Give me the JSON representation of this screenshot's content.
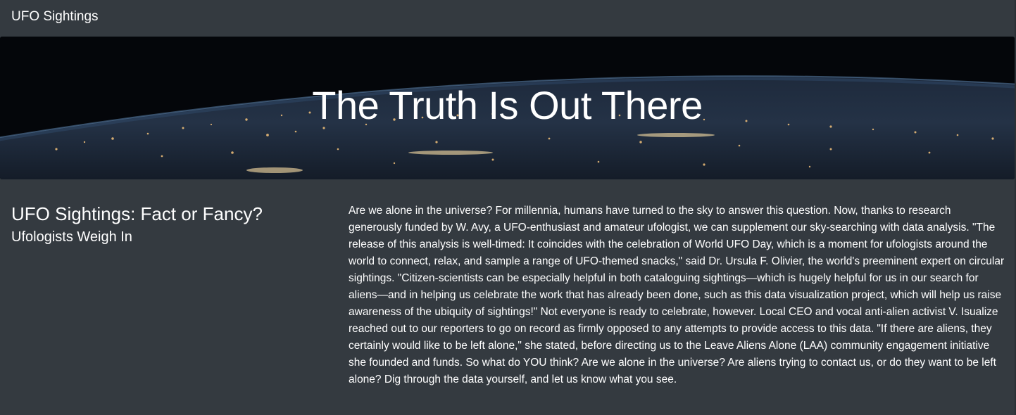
{
  "navbar": {
    "brand": "UFO Sightings"
  },
  "hero": {
    "title": "The Truth Is Out There"
  },
  "article": {
    "heading": "UFO Sightings: Fact or Fancy?",
    "subheading": "Ufologists Weigh In",
    "body": "Are we alone in the universe? For millennia, humans have turned to the sky to answer this question. Now, thanks to research generously funded by W. Avy, a UFO-enthusiast and amateur ufologist, we can supplement our sky-searching with data analysis. \"The release of this analysis is well-timed: It coincides with the celebration of World UFO Day, which is a moment for ufologists around the world to connect, relax, and sample a range of UFO-themed snacks,\" said Dr. Ursula F. Olivier, the world's preeminent expert on circular sightings. \"Citizen-scientists can be especially helpful in both cataloguing sightings—which is hugely helpful for us in our search for aliens—and in helping us celebrate the work that has already been done, such as this data visualization project, which will help us raise awareness of the ubiquity of sightings!\" Not everyone is ready to celebrate, however. Local CEO and vocal anti-alien activist V. Isualize reached out to our reporters to go on record as firmly opposed to any attempts to provide access to this data. \"If there are aliens, they certainly would like to be left alone,\" she stated, before directing us to the Leave Aliens Alone (LAA) community engagement initiative she founded and funds. So what do YOU think? Are we alone in the universe? Are aliens trying to contact us, or do they want to be left alone? Dig through the data yourself, and let us know what you see."
  },
  "colors": {
    "background": "#343a40",
    "text": "#ffffff"
  }
}
